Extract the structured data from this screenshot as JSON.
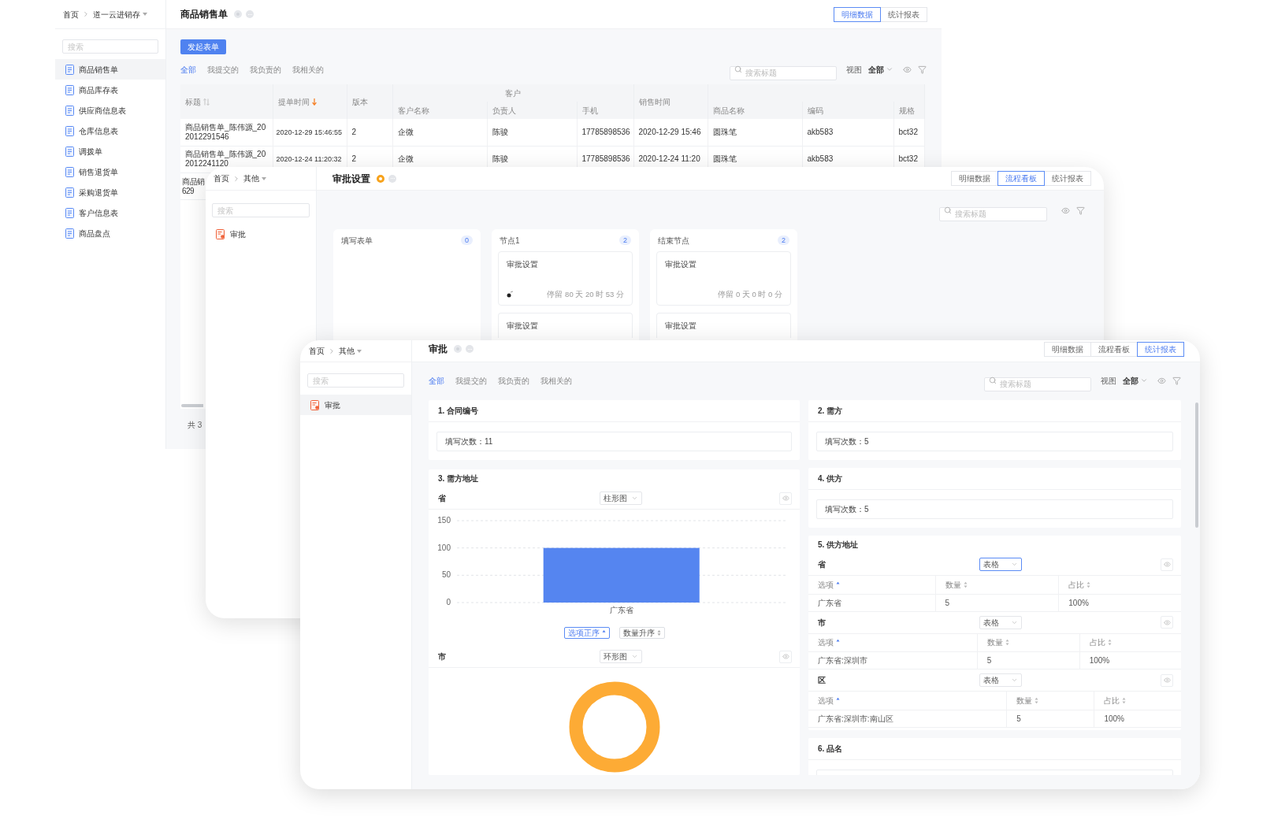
{
  "sales_window": {
    "breadcrumb": [
      "首页",
      "道一云进销存"
    ],
    "title": "商品销售单",
    "starred": false,
    "view_tabs": [
      {
        "label": "明细数据",
        "selected": true
      },
      {
        "label": "统计报表",
        "selected": false
      }
    ],
    "sidebar": {
      "search_placeholder": "搜索",
      "items": [
        {
          "label": "商品销售单",
          "selected": true
        },
        {
          "label": "商品库存表",
          "selected": false
        },
        {
          "label": "供应商信息表",
          "selected": false
        },
        {
          "label": "仓库信息表",
          "selected": false
        },
        {
          "label": "调拨单",
          "selected": false
        },
        {
          "label": "销售退货单",
          "selected": false
        },
        {
          "label": "采购退货单",
          "selected": false
        },
        {
          "label": "客户信息表",
          "selected": false
        },
        {
          "label": "商品盘点",
          "selected": false
        }
      ]
    },
    "create_button": "发起表单",
    "filter_tabs": [
      {
        "label": "全部",
        "selected": true
      },
      {
        "label": "我提交的",
        "selected": false
      },
      {
        "label": "我负责的",
        "selected": false
      },
      {
        "label": "我相关的",
        "selected": false
      }
    ],
    "search_placeholder": "搜索标题",
    "view_label": "视图",
    "view_value": "全部",
    "table": {
      "header": [
        {
          "kind": "column",
          "label": "标题",
          "sort_icon": true
        },
        {
          "kind": "column",
          "label": "提单时间",
          "sorted_descending": true
        },
        {
          "kind": "column",
          "label": "版本"
        },
        {
          "kind": "group",
          "label": "客户",
          "columns": [
            {
              "label": "客户名称"
            },
            {
              "label": "负责人"
            },
            {
              "label": "手机"
            }
          ]
        },
        {
          "kind": "column",
          "label": "销售时间"
        },
        {
          "kind": "blank_group",
          "columns": [
            {
              "label": "商品名称"
            },
            {
              "label": "编码"
            },
            {
              "label": "规格"
            }
          ]
        }
      ],
      "rows": [
        {
          "kind": "full",
          "cells": [
            "商品销售单_陈伟源_202012291546",
            "2020-12-29 15:46:55",
            "2",
            "企微",
            "陈骏",
            "17785898536",
            "2020-12-29 15:46",
            "圆珠笔",
            "akb583",
            "bct32"
          ]
        },
        {
          "kind": "full",
          "cells": [
            "商品销售单_陈伟源_202012241120",
            "2020-12-24 11:20:32",
            "2",
            "企微",
            "陈骏",
            "17785898536",
            "2020-12-24 11:20",
            "圆珠笔",
            "akb583",
            "bct32"
          ]
        },
        {
          "kind": "partial",
          "title_parts": [
            "商品销",
            "629"
          ]
        }
      ]
    },
    "total": "共 3"
  },
  "approval_settings_window": {
    "breadcrumb": [
      "首页",
      "其他"
    ],
    "title": "审批设置",
    "starred": true,
    "view_tabs": [
      {
        "label": "明细数据",
        "selected": false
      },
      {
        "label": "流程看板",
        "selected": true
      },
      {
        "label": "统计报表",
        "selected": false
      }
    ],
    "sidebar": {
      "search_placeholder": "搜索",
      "items": [
        {
          "label": "审批",
          "selected": false
        }
      ]
    },
    "search_placeholder": "搜索标题",
    "lanes": [
      {
        "title": "填写表单",
        "count": "0"
      },
      {
        "title": "节点1",
        "count": "2",
        "cards": [
          {
            "title": "审批设置",
            "duration": "停留 80 天 20 时 53 分",
            "avatar": true
          },
          {
            "title": "审批设置"
          }
        ]
      },
      {
        "title": "结束节点",
        "count": "2",
        "cards": [
          {
            "title": "审批设置",
            "duration": "停留 0 天 0 时 0 分",
            "avatar": false
          },
          {
            "title": "审批设置"
          }
        ]
      }
    ]
  },
  "approval_window": {
    "breadcrumb": [
      "首页",
      "其他"
    ],
    "title": "审批",
    "starred": false,
    "view_tabs": [
      {
        "label": "明细数据",
        "selected": false
      },
      {
        "label": "流程看板",
        "selected": false
      },
      {
        "label": "统计报表",
        "selected": true
      }
    ],
    "sidebar": {
      "search_placeholder": "搜索",
      "items": [
        {
          "label": "审批",
          "selected": true
        }
      ]
    },
    "filter_tabs": [
      {
        "label": "全部",
        "selected": true
      },
      {
        "label": "我提交的",
        "selected": false
      },
      {
        "label": "我负责的",
        "selected": false
      },
      {
        "label": "我相关的",
        "selected": false
      }
    ],
    "search_placeholder": "搜索标题",
    "view_label": "视图",
    "view_value": "全部",
    "left_cards": [
      {
        "kind": "count",
        "title": "1. 合同编号",
        "text": "填写次数：11"
      },
      {
        "kind": "fields",
        "title": "3. 需方地址",
        "fields": [
          {
            "kind": "bar",
            "label": "省",
            "select": {
              "value": "柱形图",
              "active": false
            },
            "chart_data": {
              "type": "bar",
              "categories": [
                "广东省"
              ],
              "values": [
                100
              ],
              "yticks": [
                0,
                50,
                100,
                150
              ],
              "ylim": [
                0,
                150
              ]
            },
            "sort_buttons": [
              {
                "label": "选项正序",
                "selected": true
              },
              {
                "label": "数量升序",
                "selected": false
              }
            ]
          },
          {
            "kind": "donut",
            "label": "市",
            "select": {
              "value": "环形图",
              "active": false
            }
          }
        ]
      }
    ],
    "right_cards": [
      {
        "kind": "count",
        "title": "2. 需方",
        "text": "填写次数：5"
      },
      {
        "kind": "count",
        "title": "4. 供方",
        "text": "填写次数：5"
      },
      {
        "kind": "fields",
        "title": "5. 供方地址",
        "fields": [
          {
            "kind": "table",
            "label": "省",
            "select": {
              "value": "表格",
              "active": true
            },
            "columns": [
              {
                "label": "选项",
                "sorted": true
              },
              {
                "label": "数量",
                "sorted": false
              },
              {
                "label": "占比",
                "sorted": false
              }
            ],
            "rows": [
              [
                "广东省",
                "5",
                "100%"
              ]
            ]
          },
          {
            "kind": "table",
            "label": "市",
            "select": {
              "value": "表格",
              "active": false
            },
            "columns": [
              {
                "label": "选项",
                "sorted": true
              },
              {
                "label": "数量",
                "sorted": false
              },
              {
                "label": "占比",
                "sorted": false
              }
            ],
            "rows": [
              [
                "广东省:深圳市",
                "5",
                "100%"
              ]
            ]
          },
          {
            "kind": "table",
            "label": "区",
            "select": {
              "value": "表格",
              "active": false
            },
            "columns": [
              {
                "label": "选项",
                "sorted": true
              },
              {
                "label": "数量",
                "sorted": false
              },
              {
                "label": "占比",
                "sorted": false
              }
            ],
            "rows": [
              [
                "广东省:深圳市:南山区",
                "5",
                "100%"
              ]
            ]
          }
        ]
      },
      {
        "kind": "count",
        "title": "6. 品名"
      }
    ]
  }
}
